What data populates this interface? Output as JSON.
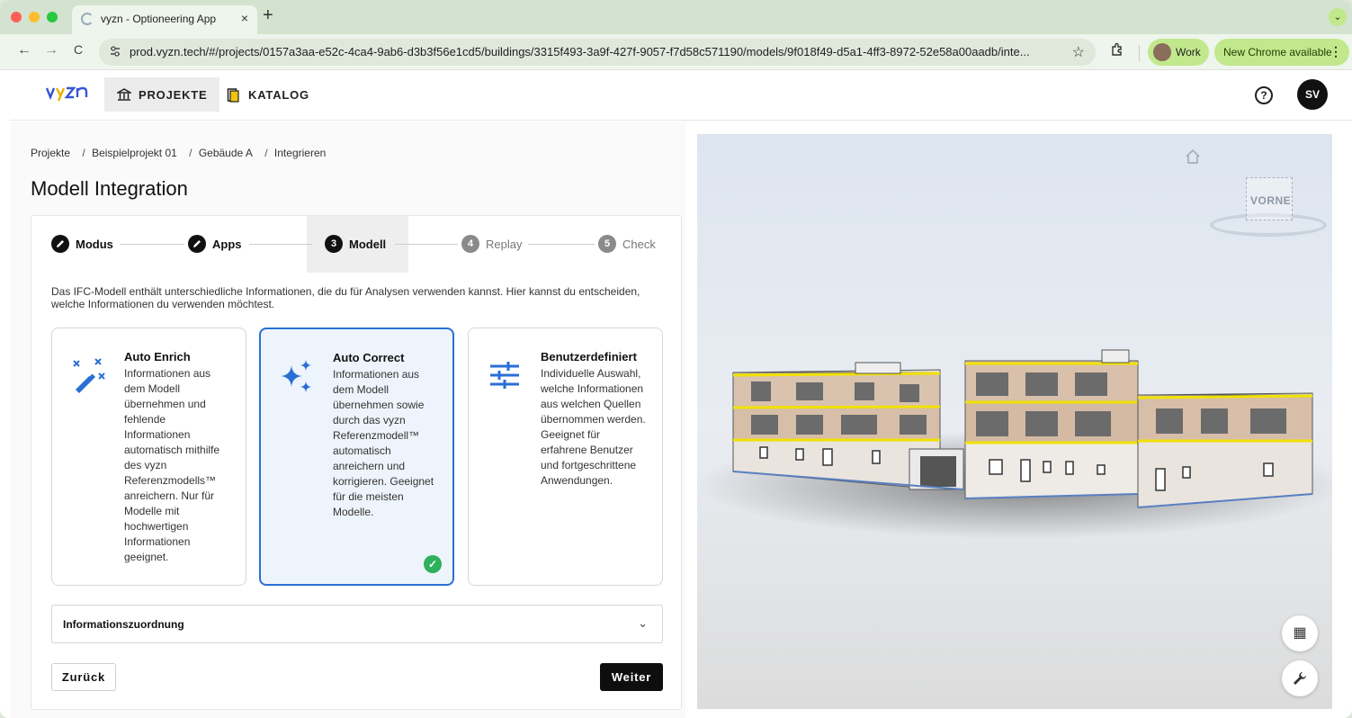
{
  "browser": {
    "tab_title": "vyzn - Optioneering App",
    "tab_close": "×",
    "new_tab": "+",
    "tab_menu": "⌄",
    "url": "prod.vyzn.tech/#/projects/0157a3aa-e52c-4ca4-9ab6-d3b3f56e1cd5/buildings/3315f493-3a9f-427f-9057-f7d58c571190/models/9f018f49-d5a1-4ff3-8972-52e58a00aadb/inte...",
    "profile_label": "Work",
    "update_label": "New Chrome available",
    "back_icon": "←",
    "forward_icon": "→",
    "reload_icon": "C",
    "star_icon": "☆",
    "kebab_icon": "⋮"
  },
  "header": {
    "logo": "vyzn",
    "nav": [
      {
        "label": "PROJEKTE",
        "active": true
      },
      {
        "label": "KATALOG",
        "active": false
      }
    ],
    "help_icon": "?",
    "user_initials": "SV"
  },
  "breadcrumb": [
    "Projekte",
    "Beispielprojekt 01",
    "Gebäude A",
    "Integrieren"
  ],
  "breadcrumb_sep": "/",
  "page_title": "Modell Integration",
  "steps": [
    {
      "number": "",
      "label": "Modus",
      "state": "done"
    },
    {
      "number": "",
      "label": "Apps",
      "state": "done"
    },
    {
      "number": "3",
      "label": "Modell",
      "state": "current"
    },
    {
      "number": "4",
      "label": "Replay",
      "state": "todo"
    },
    {
      "number": "5",
      "label": "Check",
      "state": "todo"
    }
  ],
  "intro": "Das IFC-Modell enthält unterschiedliche Informationen, die du für Analysen verwenden kannst. Hier kannst du entscheiden, welche Informationen du verwenden möchtest.",
  "options": [
    {
      "title": "Auto Enrich",
      "description": "Informationen aus dem Modell übernehmen und fehlende Informationen automatisch mithilfe des vyzn Referenzmodells™ anreichern. Nur für Modelle mit hochwertigen Informationen geeignet.",
      "icon": "magic-wand-icon",
      "selected": false
    },
    {
      "title": "Auto Correct",
      "description": "Informationen aus dem Modell übernehmen sowie durch das vyzn Referenzmodell™ automatisch anreichern und korrigieren. Geeignet für die meisten Modelle.",
      "icon": "sparkles-icon",
      "selected": true
    },
    {
      "title": "Benutzerdefiniert",
      "description": "Individuelle Auswahl, welche Informationen aus welchen Quellen übernommen werden. Geeignet für erfahrene Benutzer und fortgeschrittene Anwendungen.",
      "icon": "sliders-icon",
      "selected": false
    }
  ],
  "accordion": {
    "label": "Informationszuordnung",
    "chevron": "⌄"
  },
  "buttons": {
    "back": "Zurück",
    "next": "Weiter"
  },
  "viewer": {
    "viewcube_label": "VORNE",
    "grid_icon": "▦",
    "wrench_icon": "🔧"
  },
  "colors": {
    "accent_blue": "#2a6fd6",
    "check_green": "#2fb05a",
    "brand_yellow": "#e6b400",
    "brand_blue": "#3656d6"
  }
}
